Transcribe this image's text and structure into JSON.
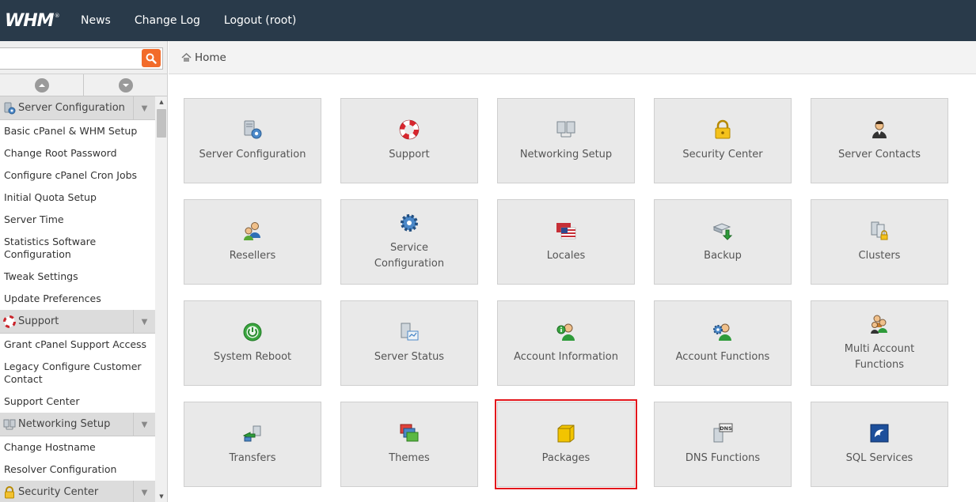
{
  "app": {
    "logo_text": "WHM",
    "logo_reg": "®",
    "nav": [
      {
        "label": "News"
      },
      {
        "label": "Change Log"
      },
      {
        "label": "Logout (root)"
      }
    ]
  },
  "search": {
    "value": "",
    "placeholder": "",
    "button_icon": "search-icon"
  },
  "breadcrumb": {
    "home_label": "Home",
    "icon": "home-icon"
  },
  "sidebar": {
    "sections": [
      {
        "title": "Server Configuration",
        "icon": "server-configuration-icon",
        "items": [
          "Basic cPanel & WHM Setup",
          "Change Root Password",
          "Configure cPanel Cron Jobs",
          "Initial Quota Setup",
          "Server Time",
          "Statistics Software Configuration",
          "Tweak Settings",
          "Update Preferences"
        ]
      },
      {
        "title": "Support",
        "icon": "lifebuoy-icon",
        "items": [
          "Grant cPanel Support Access",
          "Legacy Configure Customer Contact",
          "Support Center"
        ]
      },
      {
        "title": "Networking Setup",
        "icon": "networking-icon",
        "items": [
          "Change Hostname",
          "Resolver Configuration"
        ]
      },
      {
        "title": "Security Center",
        "icon": "lock-icon",
        "items": []
      }
    ]
  },
  "tiles": [
    {
      "label": "Server Configuration",
      "icon": "server-gear-icon"
    },
    {
      "label": "Support",
      "icon": "lifebuoy-icon"
    },
    {
      "label": "Networking Setup",
      "icon": "networked-computers-icon"
    },
    {
      "label": "Security Center",
      "icon": "padlock-icon"
    },
    {
      "label": "Server Contacts",
      "icon": "contact-person-icon"
    },
    {
      "label": "Resellers",
      "icon": "reseller-users-icon"
    },
    {
      "label": "Service Configuration",
      "icon": "gear-icon"
    },
    {
      "label": "Locales",
      "icon": "flag-icon"
    },
    {
      "label": "Backup",
      "icon": "backup-drive-icon"
    },
    {
      "label": "Clusters",
      "icon": "cluster-servers-icon"
    },
    {
      "label": "System Reboot",
      "icon": "power-icon"
    },
    {
      "label": "Server Status",
      "icon": "server-status-icon"
    },
    {
      "label": "Account Information",
      "icon": "account-info-icon"
    },
    {
      "label": "Account Functions",
      "icon": "account-gear-icon"
    },
    {
      "label": "Multi Account Functions",
      "icon": "multi-user-icon"
    },
    {
      "label": "Transfers",
      "icon": "transfer-icon"
    },
    {
      "label": "Themes",
      "icon": "themes-icon"
    },
    {
      "label": "Packages",
      "icon": "package-box-icon",
      "highlighted": true
    },
    {
      "label": "DNS Functions",
      "icon": "dns-server-icon"
    },
    {
      "label": "SQL Services",
      "icon": "mysql-dolphin-icon"
    }
  ],
  "colors": {
    "topbar": "#293a4a",
    "search_button": "#f26b2a",
    "highlight_border": "#e3161b",
    "tile_bg": "#e9e9e9"
  }
}
